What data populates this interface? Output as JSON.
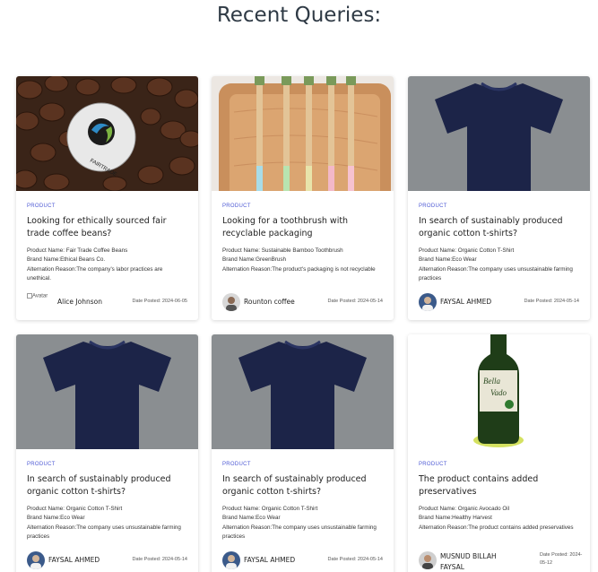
{
  "page": {
    "heading": "Recent Queries:"
  },
  "cards": [
    {
      "image": "fairtrade-coffee-beans",
      "tag": "PRODUCT",
      "title": "Looking for ethically sourced fair trade coffee beans?",
      "product_name": "Product Name: Fair Trade Coffee Beans",
      "brand_name": "Brand Name:Ethical Beans Co.",
      "reason": "Alternation Reason:The company's labor practices are unethical.",
      "avatar_alt": "Avatar",
      "author": "Alice Johnson",
      "date": "Date Posted: 2024-06-05"
    },
    {
      "image": "bamboo-toothbrushes",
      "tag": "PRODUCT",
      "title": "Looking for a toothbrush with recyclable packaging",
      "product_name": "Product Name: Sustainable Bamboo Toothbrush",
      "brand_name": "Brand Name:GreenBrush",
      "reason": "Alternation Reason:The product's packaging is not recyclable",
      "author": "Rounton coffee",
      "date": "Date Posted: 2024-05-14"
    },
    {
      "image": "navy-tshirt",
      "tag": "PRODUCT",
      "title": "In search of sustainably produced organic cotton t-shirts?",
      "product_name": "Product Name: Organic Cotton T-Shirt",
      "brand_name": "Brand Name:Eco Wear",
      "reason": "Alternation Reason:The company uses unsustainable farming practices",
      "author": "FAYSAL AHMED",
      "date": "Date Posted: 2024-05-14"
    },
    {
      "image": "navy-tshirt",
      "tag": "PRODUCT",
      "title": "In search of sustainably produced organic cotton t-shirts?",
      "product_name": "Product Name: Organic Cotton T-Shirt",
      "brand_name": "Brand Name:Eco Wear",
      "reason": "Alternation Reason:The company uses unsustainable farming practices",
      "author": "FAYSAL AHMED",
      "date": "Date Posted: 2024-05-14"
    },
    {
      "image": "navy-tshirt",
      "tag": "PRODUCT",
      "title": "In search of sustainably produced organic cotton t-shirts?",
      "product_name": "Product Name: Organic Cotton T-Shirt",
      "brand_name": "Brand Name:Eco Wear",
      "reason": "Alternation Reason:The company uses unsustainable farming practices",
      "author": "FAYSAL AHMED",
      "date": "Date Posted: 2024-05-14"
    },
    {
      "image": "avocado-oil-bottle",
      "tag": "PRODUCT",
      "title": "The product contains added preservatives",
      "product_name": "Product Name: Organic Avocado Oil",
      "brand_name": "Brand Name:Healthy Harvest",
      "reason": "Alternation Reason:The product contains added preservatives",
      "author": "MUSNUD BILLAH FAYSAL",
      "date": "Date Posted: 2024-05-12"
    }
  ]
}
